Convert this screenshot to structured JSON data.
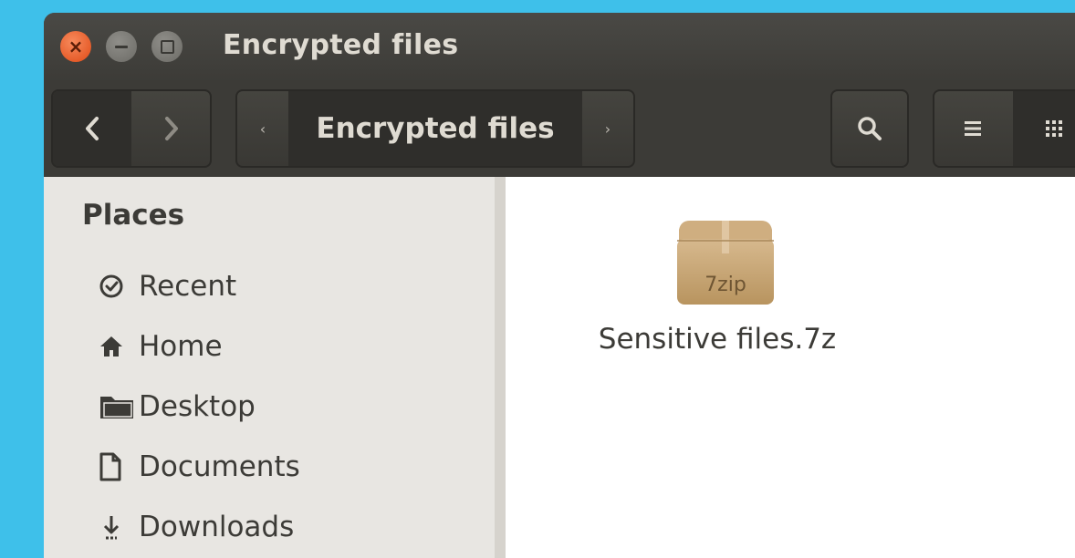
{
  "window": {
    "title": "Encrypted files"
  },
  "toolbar": {
    "back_icon": "chevron-left-icon",
    "forward_icon": "chevron-right-icon",
    "breadcrumb_current": "Encrypted files",
    "search_icon": "search-icon",
    "list_view_icon": "list-view-icon",
    "grid_view_icon": "grid-view-icon"
  },
  "sidebar": {
    "header": "Places",
    "items": [
      {
        "label": "Recent",
        "icon": "clock-icon"
      },
      {
        "label": "Home",
        "icon": "home-icon"
      },
      {
        "label": "Desktop",
        "icon": "folder-icon"
      },
      {
        "label": "Documents",
        "icon": "document-icon"
      },
      {
        "label": "Downloads",
        "icon": "download-icon"
      }
    ]
  },
  "files": [
    {
      "name": "Sensitive files.7z",
      "icon_label": "7zip",
      "icon": "archive-box-icon"
    }
  ],
  "colors": {
    "desktop_bg": "#3ec0ea",
    "titlebar": "#3c3b37",
    "close_button": "#df4a16",
    "sidebar_bg": "#e8e6e2",
    "content_bg": "#ffffff"
  }
}
